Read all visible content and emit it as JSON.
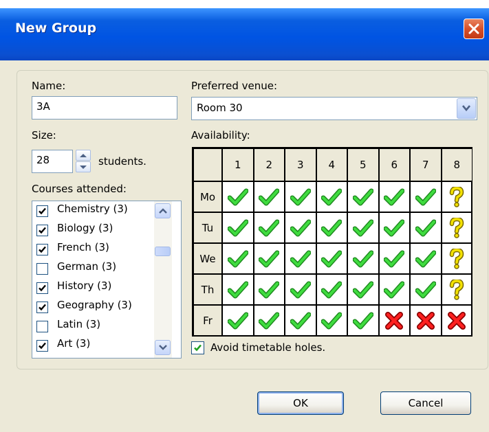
{
  "window": {
    "title": "New Group",
    "close_icon": "close-icon"
  },
  "form": {
    "name_label": "Name:",
    "name_value": "3A",
    "size_label": "Size:",
    "size_value": "28",
    "size_unit": "students.",
    "courses_label": "Courses attended:",
    "courses": [
      {
        "label": "Chemistry (3)",
        "checked": true
      },
      {
        "label": "Biology (3)",
        "checked": true
      },
      {
        "label": "French (3)",
        "checked": true
      },
      {
        "label": "German (3)",
        "checked": false
      },
      {
        "label": "History (3)",
        "checked": true
      },
      {
        "label": "Geography (3)",
        "checked": true
      },
      {
        "label": "Latin (3)",
        "checked": false
      },
      {
        "label": "Art (3)",
        "checked": true
      }
    ],
    "venue_label": "Preferred venue:",
    "venue_value": "Room 30",
    "availability_label": "Availability:",
    "avoid_holes_label": "Avoid timetable holes.",
    "avoid_holes_checked": true
  },
  "availability": {
    "periods": [
      "1",
      "2",
      "3",
      "4",
      "5",
      "6",
      "7",
      "8"
    ],
    "days": [
      "Mo",
      "Tu",
      "We",
      "Th",
      "Fr"
    ],
    "rows": [
      [
        "yes",
        "yes",
        "yes",
        "yes",
        "yes",
        "yes",
        "yes",
        "maybe"
      ],
      [
        "yes",
        "yes",
        "yes",
        "yes",
        "yes",
        "yes",
        "yes",
        "maybe"
      ],
      [
        "yes",
        "yes",
        "yes",
        "yes",
        "yes",
        "yes",
        "yes",
        "maybe"
      ],
      [
        "yes",
        "yes",
        "yes",
        "yes",
        "yes",
        "yes",
        "yes",
        "maybe"
      ],
      [
        "yes",
        "yes",
        "yes",
        "yes",
        "yes",
        "no",
        "no",
        "no"
      ]
    ],
    "icon_names": {
      "yes": "green-check-icon",
      "maybe": "yellow-question-icon",
      "no": "red-x-icon"
    },
    "colors": {
      "yes": "#2eb82e",
      "maybe": "#f2e000",
      "no": "#e01010"
    }
  },
  "buttons": {
    "ok": "OK",
    "cancel": "Cancel"
  },
  "colors": {
    "titlebar": "#0054e3",
    "dialog_bg": "#ece9d8",
    "close_button": "#d8502a"
  }
}
